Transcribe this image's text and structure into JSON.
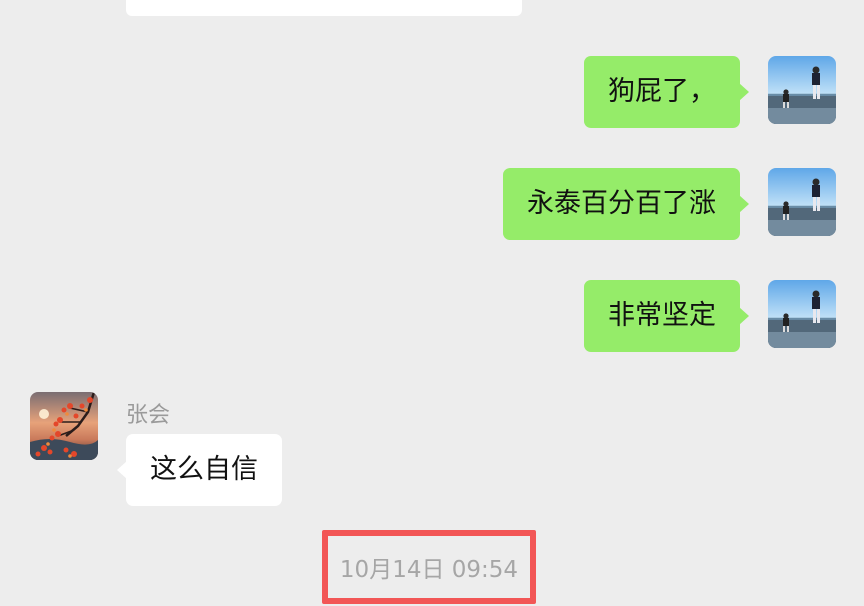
{
  "conversation": {
    "messages": [
      {
        "direction": "outgoing",
        "text": "狗屁了，",
        "avatar": "beach-photo-avatar"
      },
      {
        "direction": "outgoing",
        "text": "永泰百分百了涨",
        "avatar": "beach-photo-avatar"
      },
      {
        "direction": "outgoing",
        "text": "非常坚定",
        "avatar": "beach-photo-avatar"
      },
      {
        "direction": "incoming",
        "sender": "张会",
        "text": "这么自信",
        "avatar": "sunset-tree-avatar"
      }
    ],
    "timestamp": "10月14日 09:54"
  },
  "colors": {
    "background": "#ededed",
    "outgoing_bubble": "#95ec69",
    "incoming_bubble": "#ffffff",
    "highlight_border": "#f25656",
    "timestamp_text": "#a6a6a6",
    "sender_name_text": "#9a9a9a"
  }
}
